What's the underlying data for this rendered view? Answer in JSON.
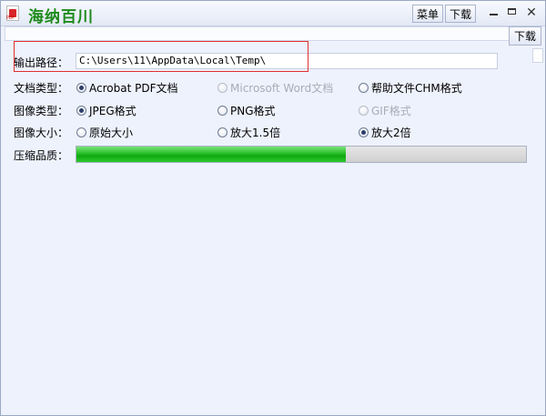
{
  "app": {
    "title": "海纳百川"
  },
  "toolbar": {
    "menu_label": "菜单",
    "download_label": "下载",
    "download_label_2": "下载"
  },
  "output": {
    "label": "输出路径：",
    "path": "C:\\Users\\11\\AppData\\Local\\Temp\\"
  },
  "doc_type": {
    "label": "文档类型：",
    "options": [
      {
        "label": "Acrobat PDF文档",
        "checked": true,
        "disabled": false
      },
      {
        "label": "Microsoft Word文档",
        "checked": false,
        "disabled": true
      },
      {
        "label": "帮助文件CHM格式",
        "checked": false,
        "disabled": false
      }
    ]
  },
  "image_type": {
    "label": "图像类型：",
    "options": [
      {
        "label": "JPEG格式",
        "checked": true,
        "disabled": false
      },
      {
        "label": "PNG格式",
        "checked": false,
        "disabled": false
      },
      {
        "label": "GIF格式",
        "checked": false,
        "disabled": true
      }
    ]
  },
  "image_size": {
    "label": "图像大小：",
    "options": [
      {
        "label": "原始大小",
        "checked": false,
        "disabled": false
      },
      {
        "label": "放大1.5倍",
        "checked": false,
        "disabled": false
      },
      {
        "label": "放大2倍",
        "checked": true,
        "disabled": false
      }
    ]
  },
  "quality": {
    "label": "压缩品质：",
    "value_percent": 60
  },
  "colors": {
    "title_green": "#1d8a1a",
    "progress_green": "#10a810",
    "highlight_red": "#e03030"
  }
}
